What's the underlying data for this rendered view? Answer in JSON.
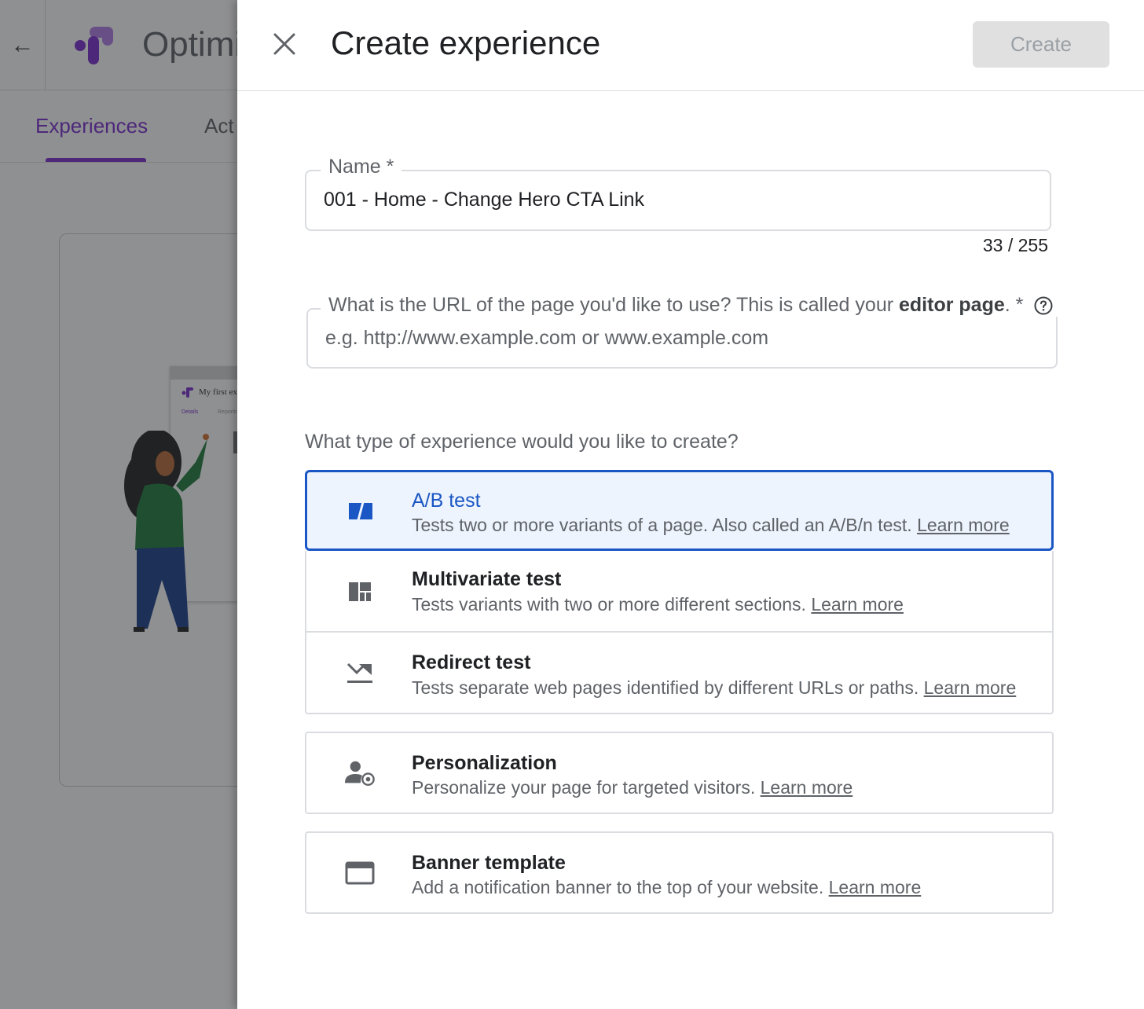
{
  "background": {
    "app_title": "Optimi",
    "tabs": [
      "Experiences",
      "Act"
    ],
    "preview": {
      "title": "My first exp",
      "tab_details": "Details",
      "tab_reporting": "Reportin"
    }
  },
  "dialog": {
    "title": "Create experience",
    "create_label": "Create",
    "name_field": {
      "label": "Name *",
      "value": "001 - Home - Change Hero CTA Link",
      "counter": "33 / 255"
    },
    "url_field": {
      "label_pre": "What is the URL of the page you'd like to use? This is called your ",
      "label_bold": "editor page",
      "label_post": ". *",
      "placeholder": "e.g. http://www.example.com or www.example.com"
    },
    "type_question": "What type of experience would you like to create?",
    "options": [
      {
        "title": "A/B test",
        "desc": "Tests two or more variants of a page. Also called an A/B/n test.",
        "link": "Learn more",
        "icon": "ab-test-icon",
        "selected": true
      },
      {
        "title": "Multivariate test",
        "desc": "Tests variants with two or more different sections.",
        "link": "Learn more",
        "icon": "multivariate-icon"
      },
      {
        "title": "Redirect test",
        "desc": "Tests separate web pages identified by different URLs or paths.",
        "link": "Learn more",
        "icon": "redirect-icon"
      },
      {
        "title": "Personalization",
        "desc": "Personalize your page for targeted visitors.",
        "link": "Learn more",
        "icon": "personalization-icon"
      },
      {
        "title": "Banner template",
        "desc": "Add a notification banner to the top of your website.",
        "link": "Learn more",
        "icon": "banner-icon"
      }
    ]
  },
  "colors": {
    "accent_blue": "#1a56c4",
    "selected_bg": "#eef4fd",
    "brand_purple": "#7b2fd0"
  }
}
